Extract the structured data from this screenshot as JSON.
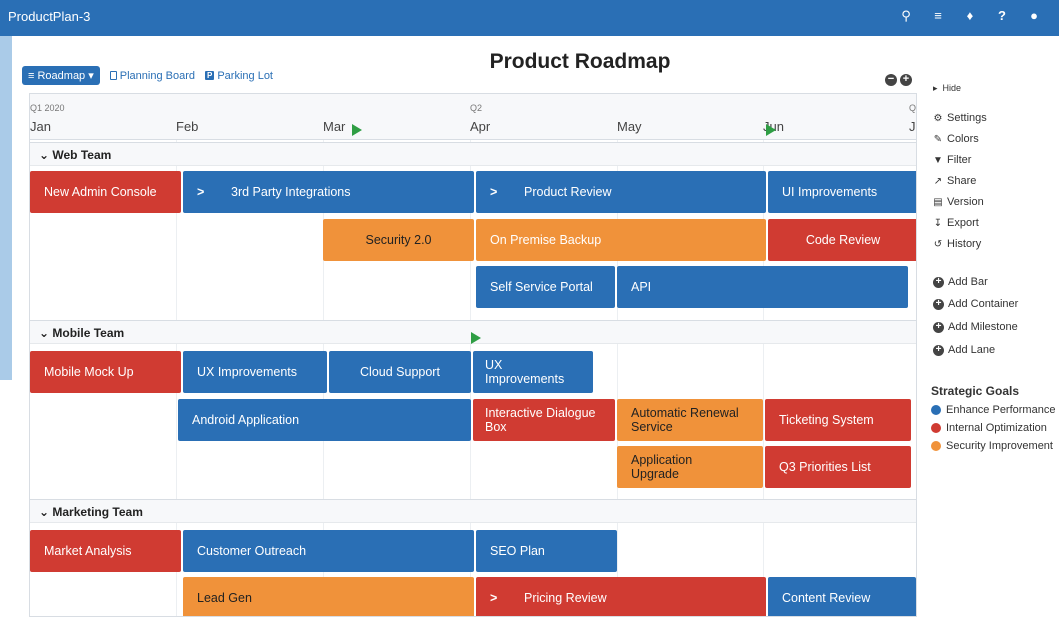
{
  "app": {
    "title": "ProductPlan-3"
  },
  "toolbar_icons": [
    "search-icon",
    "filter-lines-icon",
    "bell-icon",
    "help-icon",
    "user-icon"
  ],
  "page": {
    "title": "Product Roadmap"
  },
  "views": {
    "roadmap": "Roadmap",
    "planning_board": "Planning Board",
    "parking_lot": "Parking Lot",
    "parking_badge": "P"
  },
  "zoom": {
    "out": "−",
    "in": "+"
  },
  "timeline": {
    "quarters": [
      "Q1 2020",
      "Q2",
      "Q"
    ],
    "months": [
      "Jan",
      "Feb",
      "Mar",
      "Apr",
      "May",
      "Jun",
      "J"
    ]
  },
  "colors": {
    "blue": "#2a6fb5",
    "red": "#d03b32",
    "orange": "#f0923a",
    "milestone": "#2f9e44"
  },
  "lanes": [
    {
      "name": "Web Team",
      "bars": [
        {
          "label": "New Admin Console",
          "color": "red"
        },
        {
          "label": "3rd Party Integrations",
          "color": "blue",
          "chevron": ">"
        },
        {
          "label": "Product Review",
          "color": "blue",
          "chevron": ">"
        },
        {
          "label": "UI Improvements",
          "color": "blue"
        },
        {
          "label": "Security 2.0",
          "color": "orange"
        },
        {
          "label": "On Premise Backup",
          "color": "orange"
        },
        {
          "label": "Code Review",
          "color": "red"
        },
        {
          "label": "Self Service Portal",
          "color": "blue"
        },
        {
          "label": "API",
          "color": "blue"
        }
      ]
    },
    {
      "name": "Mobile Team",
      "bars": [
        {
          "label": "Mobile Mock Up",
          "color": "red"
        },
        {
          "label": "UX Improvements",
          "color": "blue"
        },
        {
          "label": "Cloud Support",
          "color": "blue"
        },
        {
          "label": "UX Improvements",
          "color": "blue"
        },
        {
          "label": "Android Application",
          "color": "blue"
        },
        {
          "label": "Interactive Dialogue Box",
          "color": "red"
        },
        {
          "label": "Automatic Renewal Service",
          "color": "orange"
        },
        {
          "label": "Ticketing System",
          "color": "red"
        },
        {
          "label": "Application Upgrade",
          "color": "orange"
        },
        {
          "label": "Q3 Priorities List",
          "color": "red"
        }
      ]
    },
    {
      "name": "Marketing Team",
      "bars": [
        {
          "label": "Market Analysis",
          "color": "red"
        },
        {
          "label": "Customer Outreach",
          "color": "blue"
        },
        {
          "label": "SEO Plan",
          "color": "blue"
        },
        {
          "label": "Lead Gen",
          "color": "orange"
        },
        {
          "label": "Pricing Review",
          "color": "red",
          "chevron": ">"
        },
        {
          "label": "Content Review",
          "color": "blue"
        }
      ]
    }
  ],
  "sidebar": {
    "hide": "Hide",
    "menu": [
      "Settings",
      "Colors",
      "Filter",
      "Share",
      "Version",
      "Export",
      "History"
    ],
    "add": [
      "Add Bar",
      "Add Container",
      "Add Milestone",
      "Add Lane"
    ],
    "goals_title": "Strategic Goals",
    "goals": [
      {
        "label": "Enhance Performance",
        "color": "#2a6fb5"
      },
      {
        "label": "Internal Optimization",
        "color": "#d03b32"
      },
      {
        "label": "Security Improvement",
        "color": "#f0923a"
      }
    ]
  }
}
